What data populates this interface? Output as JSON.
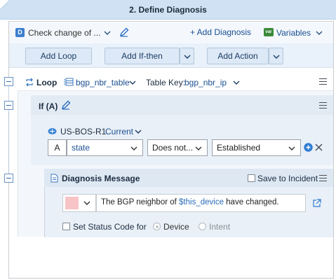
{
  "header": {
    "title": "2. Define Diagnosis"
  },
  "toolbar": {
    "diagnosis_select": "Check change of ...",
    "add_diagnosis": "+ Add Diagnosis",
    "variables_label": "Variables",
    "add_loop": "Add Loop",
    "add_if_then": "Add If-then",
    "add_action": "Add Action"
  },
  "loop": {
    "label": "Loop",
    "table_name": "bgp_nbr_table",
    "table_key_label": "Table Key:",
    "table_key_value": "bgp_nbr_ip"
  },
  "if_block": {
    "label": "If (A)",
    "device_name": "US-BOS-R1",
    "device_scope": "Current",
    "condition": {
      "alias": "A",
      "field": "state",
      "operator": "Does not...",
      "value": "Established"
    }
  },
  "diagnosis_message": {
    "title": "Diagnosis Message",
    "save_to_incident_label": "Save to Incident",
    "message_prefix": "The BGP neighbor of ",
    "message_variable": "$this_device",
    "message_suffix": " have changed.",
    "set_status_label": "Set Status Code for",
    "radio_device": "Device",
    "radio_intent": "Intent"
  },
  "colors": {
    "header_bg": "#cfe1f3",
    "accent": "#1a4f91",
    "swatch": "#f7c3c6",
    "add_icon": "#2e7bd3",
    "variable_text": "#2a6bb8"
  },
  "icons": [
    "diagnosis-icon",
    "edit-icon",
    "variables-icon",
    "loop-icon",
    "table-icon",
    "menu-icon",
    "device-icon",
    "add-circle-icon",
    "close-icon",
    "document-icon",
    "open-external-icon",
    "collapse-icon"
  ]
}
